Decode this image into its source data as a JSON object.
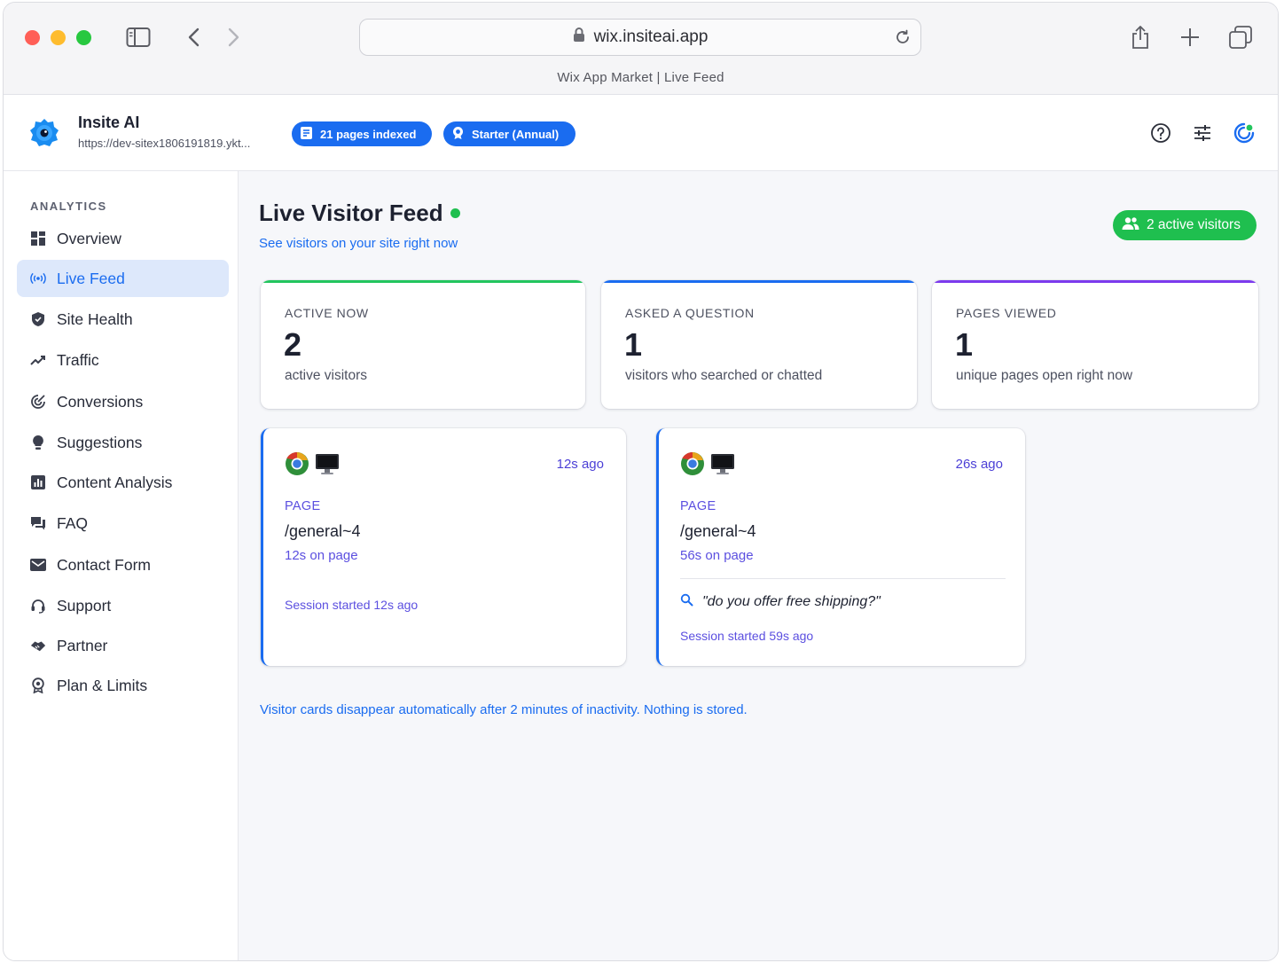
{
  "browser": {
    "url": "wix.insiteai.app",
    "tab_title": "Wix App Market | Live Feed"
  },
  "header": {
    "app_name": "Insite AI",
    "site_url": "https://dev-sitex1806191819.ykt...",
    "pages_badge": "21 pages indexed",
    "plan_badge": "Starter (Annual)"
  },
  "sidebar": {
    "section_label": "ANALYTICS",
    "items": [
      {
        "label": "Overview",
        "icon": "dashboard-icon"
      },
      {
        "label": "Live Feed",
        "icon": "broadcast-icon",
        "active": true
      },
      {
        "label": "Site Health",
        "icon": "shield-icon"
      },
      {
        "label": "Traffic",
        "icon": "trending-icon"
      },
      {
        "label": "Conversions",
        "icon": "conversions-icon"
      },
      {
        "label": "Suggestions",
        "icon": "lightbulb-icon"
      },
      {
        "label": "Content Analysis",
        "icon": "bar-chart-icon"
      },
      {
        "label": "FAQ",
        "icon": "chat-icon"
      },
      {
        "label": "Contact Form",
        "icon": "mail-icon"
      },
      {
        "label": "Support",
        "icon": "headset-icon"
      },
      {
        "label": "Partner",
        "icon": "handshake-icon"
      },
      {
        "label": "Plan & Limits",
        "icon": "award-icon"
      }
    ]
  },
  "main": {
    "title": "Live Visitor Feed",
    "subtitle": "See visitors on your site right now",
    "active_badge": "2 active visitors",
    "stats": [
      {
        "label": "ACTIVE NOW",
        "value": "2",
        "desc": "active visitors",
        "color": "#22c55e"
      },
      {
        "label": "ASKED A QUESTION",
        "value": "1",
        "desc": "visitors who searched or chatted",
        "color": "#1a6cf0"
      },
      {
        "label": "PAGES VIEWED",
        "value": "1",
        "desc": "unique pages open right now",
        "color": "#7c3aed"
      }
    ],
    "visitors": [
      {
        "ago": "12s ago",
        "page_label": "PAGE",
        "path": "/general~4",
        "time_on_page": "12s on page",
        "session": "Session started 12s ago"
      },
      {
        "ago": "26s ago",
        "page_label": "PAGE",
        "path": "/general~4",
        "time_on_page": "56s on page",
        "query": "\"do you offer free shipping?\"",
        "session": "Session started 59s ago"
      }
    ],
    "footer_note": "Visitor cards disappear automatically after 2 minutes of inactivity. Nothing is stored."
  },
  "colors": {
    "accent": "#1a6cf0",
    "live_green": "#1fbf4f",
    "purple_text": "#5b4fe0"
  }
}
